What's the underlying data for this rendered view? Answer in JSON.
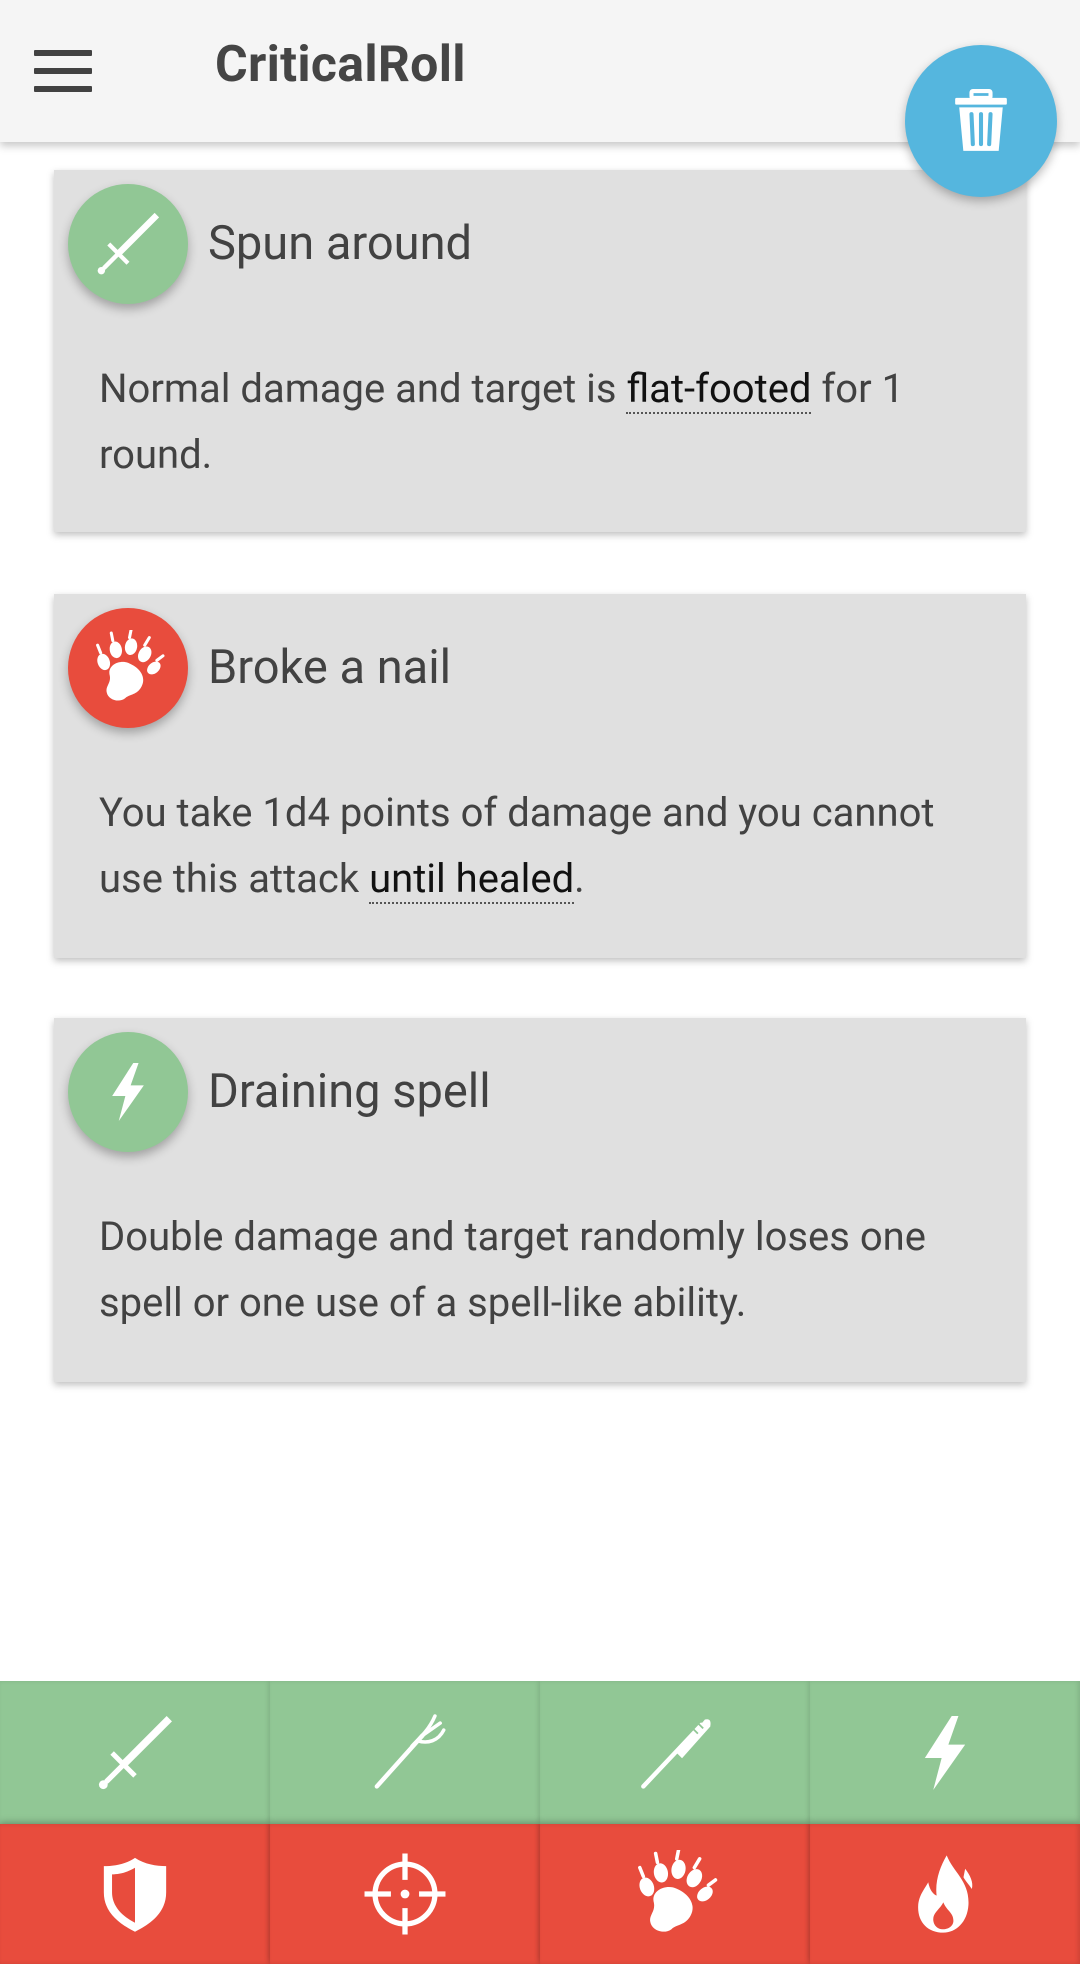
{
  "app": {
    "title": "CriticalRoll",
    "menu_icon": "hamburger-menu-icon",
    "fab_icon": "trash-icon",
    "accent_color": "#55b6de"
  },
  "cards": [
    {
      "icon": "sword-icon",
      "icon_color": "#91c795",
      "title": "Spun around",
      "text_before": "Normal damage and target is ",
      "term": "flat-footed",
      "text_after": " for 1 round."
    },
    {
      "icon": "paw-icon",
      "icon_color": "#e84c3d",
      "title": "Broke a nail",
      "text_before": "You take 1d4 points of damage and you cannot use this attack ",
      "term": "until healed",
      "text_after": "."
    },
    {
      "icon": "lightning-icon",
      "icon_color": "#91c795",
      "title": "Draining spell",
      "text": "Double damage and target randomly loses one spell or one use of a spell-like ability."
    }
  ],
  "bottom_tabs": {
    "row1_color": "#91c795",
    "row2_color": "#e84c3d",
    "row1": [
      "sword-icon",
      "trident-icon",
      "club-icon",
      "lightning-icon"
    ],
    "row2": [
      "shield-icon",
      "crosshair-icon",
      "paw-icon",
      "fire-icon"
    ]
  }
}
